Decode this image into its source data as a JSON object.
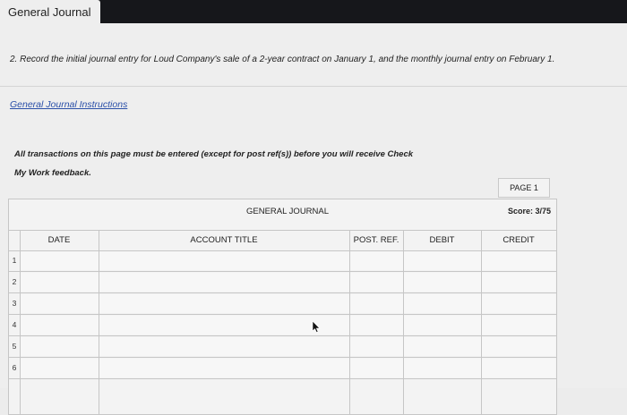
{
  "window": {
    "title": "General Journal"
  },
  "question": {
    "text": "2. Record the initial journal entry for Loud Company's sale of a 2-year contract on January 1, and the monthly journal entry on February 1."
  },
  "instructions_link": "General Journal Instructions",
  "notice": {
    "line1": "All transactions on this page must be entered (except for post ref(s)) before you will receive Check",
    "line2": "My Work feedback."
  },
  "journal": {
    "page_label": "PAGE 1",
    "title": "GENERAL JOURNAL",
    "score": "Score: 3/75",
    "columns": {
      "date": "DATE",
      "account_title": "ACCOUNT TITLE",
      "post_ref": "POST. REF.",
      "debit": "DEBIT",
      "credit": "CREDIT"
    },
    "rows": [
      "1",
      "2",
      "3",
      "4",
      "5",
      "6"
    ]
  },
  "icons": {
    "cursor": "mouse-pointer-icon"
  }
}
